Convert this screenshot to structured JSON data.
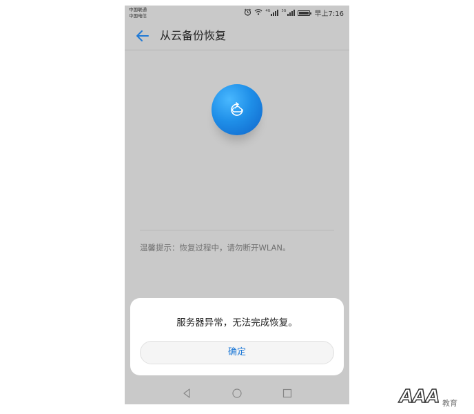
{
  "status_bar": {
    "carrier_1": "中国联通",
    "carrier_2": "中国电信",
    "network_1": "4G",
    "network_2": "3G",
    "time": "早上7:16",
    "icons": [
      "alarm-icon",
      "wifi-icon",
      "signal-icon",
      "signal-icon",
      "battery-icon"
    ]
  },
  "app_bar": {
    "title": "从云备份恢复",
    "back_icon": "back-arrow-icon"
  },
  "main": {
    "icon": "cloud-restore-icon",
    "hint": "温馨提示：恢复过程中，请勿断开WLAN。"
  },
  "dialog": {
    "message": "服务器异常，无法完成恢复。",
    "confirm_label": "确定"
  },
  "nav_bar": {
    "icons": [
      "back-triangle-icon",
      "home-circle-icon",
      "recents-square-icon"
    ]
  },
  "watermark": {
    "text": "AAA",
    "sub": "教育"
  },
  "colors": {
    "accent": "#1f79d6",
    "screen_dim": "#c9c9c9",
    "dialog_bg": "#ffffff"
  }
}
